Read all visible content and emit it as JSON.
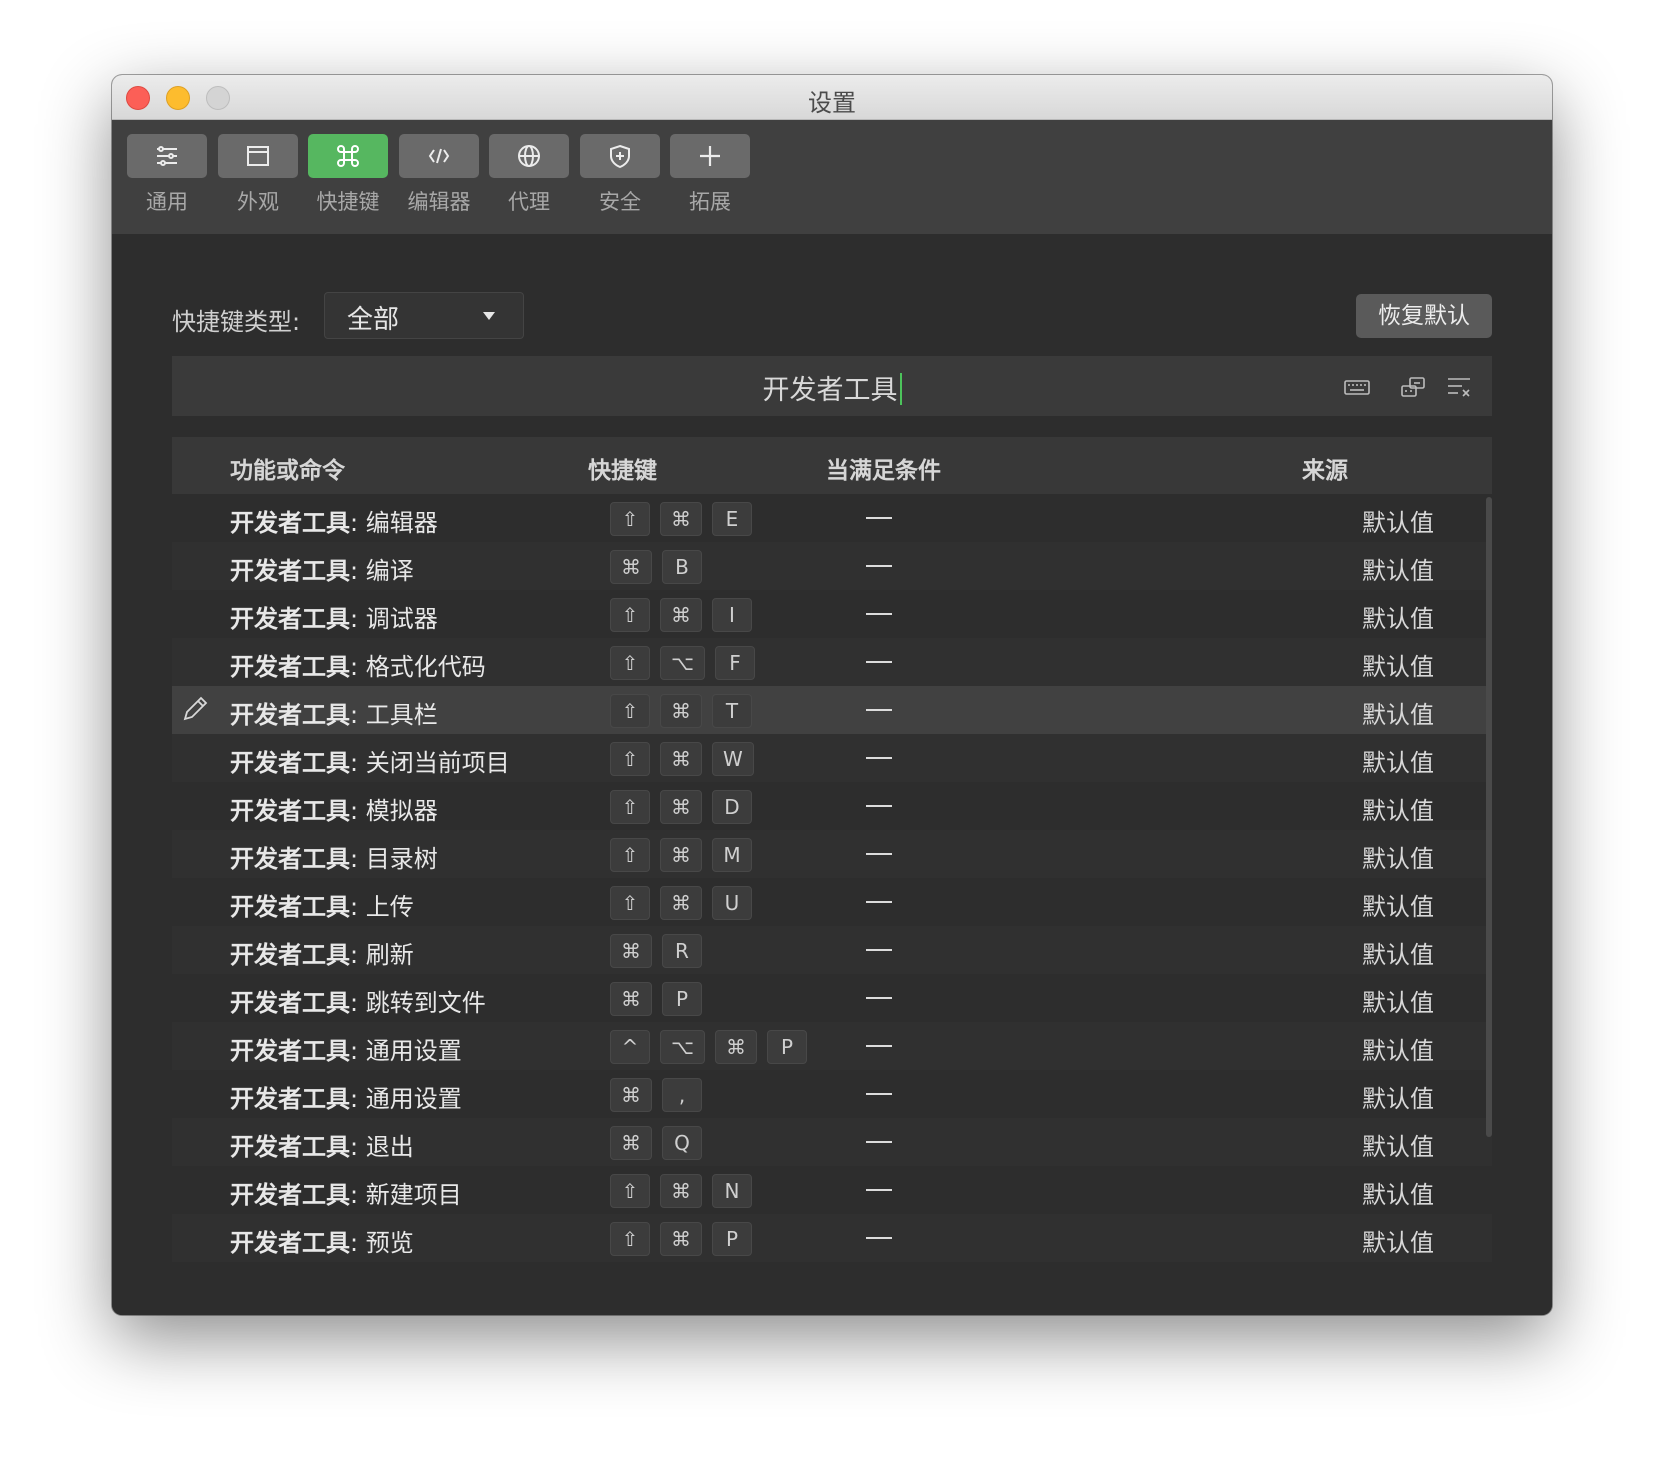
{
  "window": {
    "title": "设置"
  },
  "toolbar": {
    "items": [
      {
        "label": "通用",
        "icon": "sliders-icon"
      },
      {
        "label": "外观",
        "icon": "window-icon"
      },
      {
        "label": "快捷键",
        "icon": "command-icon",
        "active": true
      },
      {
        "label": "编辑器",
        "icon": "code-icon"
      },
      {
        "label": "代理",
        "icon": "globe-icon"
      },
      {
        "label": "安全",
        "icon": "shield-icon"
      },
      {
        "label": "拓展",
        "icon": "plus-icon"
      }
    ]
  },
  "filter": {
    "label": "快捷键类型:",
    "selected": "全部"
  },
  "reset_button": "恢复默认",
  "search": {
    "value": "开发者工具"
  },
  "table": {
    "headers": {
      "command": "功能或命令",
      "shortcut": "快捷键",
      "condition": "当满足条件",
      "source": "来源"
    },
    "rows": [
      {
        "prefix": "开发者工具",
        "name": ": 编辑器",
        "keys": [
          "⇧",
          "⌘",
          "E"
        ],
        "source": "默认值"
      },
      {
        "prefix": "开发者工具",
        "name": ": 编译",
        "keys": [
          "⌘",
          "B"
        ],
        "source": "默认值"
      },
      {
        "prefix": "开发者工具",
        "name": ": 调试器",
        "keys": [
          "⇧",
          "⌘",
          "I"
        ],
        "source": "默认值"
      },
      {
        "prefix": "开发者工具",
        "name": ": 格式化代码",
        "keys": [
          "⇧",
          "⌥",
          "F"
        ],
        "source": "默认值"
      },
      {
        "prefix": "开发者工具",
        "name": ": 工具栏",
        "keys": [
          "⇧",
          "⌘",
          "T"
        ],
        "source": "默认值",
        "selected": true
      },
      {
        "prefix": "开发者工具",
        "name": ": 关闭当前项目",
        "keys": [
          "⇧",
          "⌘",
          "W"
        ],
        "source": "默认值"
      },
      {
        "prefix": "开发者工具",
        "name": ": 模拟器",
        "keys": [
          "⇧",
          "⌘",
          "D"
        ],
        "source": "默认值"
      },
      {
        "prefix": "开发者工具",
        "name": ": 目录树",
        "keys": [
          "⇧",
          "⌘",
          "M"
        ],
        "source": "默认值"
      },
      {
        "prefix": "开发者工具",
        "name": ": 上传",
        "keys": [
          "⇧",
          "⌘",
          "U"
        ],
        "source": "默认值"
      },
      {
        "prefix": "开发者工具",
        "name": ": 刷新",
        "keys": [
          "⌘",
          "R"
        ],
        "source": "默认值"
      },
      {
        "prefix": "开发者工具",
        "name": ": 跳转到文件",
        "keys": [
          "⌘",
          "P"
        ],
        "source": "默认值"
      },
      {
        "prefix": "开发者工具",
        "name": ": 通用设置",
        "keys": [
          "^",
          "⌥",
          "⌘",
          "P"
        ],
        "source": "默认值"
      },
      {
        "prefix": "开发者工具",
        "name": ": 通用设置",
        "keys": [
          "⌘",
          ","
        ],
        "source": "默认值"
      },
      {
        "prefix": "开发者工具",
        "name": ": 退出",
        "keys": [
          "⌘",
          "Q"
        ],
        "source": "默认值"
      },
      {
        "prefix": "开发者工具",
        "name": ": 新建项目",
        "keys": [
          "⇧",
          "⌘",
          "N"
        ],
        "source": "默认值"
      },
      {
        "prefix": "开发者工具",
        "name": ": 预览",
        "keys": [
          "⇧",
          "⌘",
          "P"
        ],
        "source": "默认值"
      }
    ]
  },
  "colors": {
    "accent": "#56b760",
    "background": "#2d2d2d",
    "toolbar": "#404040"
  }
}
